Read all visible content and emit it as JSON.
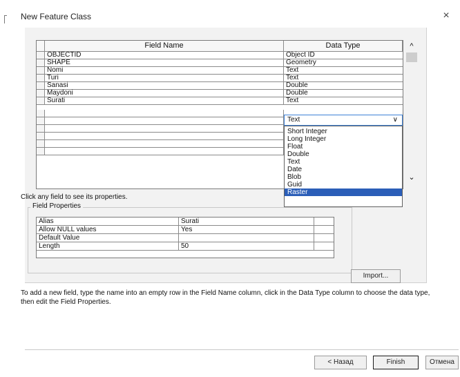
{
  "window": {
    "title": "New Feature Class",
    "close_symbol": "×"
  },
  "grid": {
    "headers": {
      "field_name": "Field Name",
      "data_type": "Data Type"
    },
    "rows": [
      {
        "name": "OBJECTID",
        "type": "Object ID"
      },
      {
        "name": "SHAPE",
        "type": "Geometry"
      },
      {
        "name": "Nomi",
        "type": "Text"
      },
      {
        "name": "Turi",
        "type": "Text"
      },
      {
        "name": "Sanasi",
        "type": "Double"
      },
      {
        "name": "Maydoni",
        "type": "Double"
      },
      {
        "name": "Surati",
        "type": "Text"
      },
      {
        "name": "",
        "type": ""
      },
      {
        "name": "",
        "type": ""
      },
      {
        "name": "",
        "type": ""
      },
      {
        "name": "",
        "type": ""
      },
      {
        "name": "",
        "type": ""
      },
      {
        "name": "",
        "type": ""
      }
    ]
  },
  "type_dropdown": {
    "selected": "Text",
    "chevron": "∨",
    "options": [
      "Short Integer",
      "Long Integer",
      "Float",
      "Double",
      "Text",
      "Date",
      "Blob",
      "Guid",
      "Raster"
    ],
    "highlighted": "Raster"
  },
  "scrollbar": {
    "up_arrow": "^",
    "down_arrow": "⌄"
  },
  "hint_text": "Click any field to see its properties.",
  "field_properties": {
    "legend": "Field Properties",
    "rows": [
      {
        "key": "Alias",
        "value": "Surati"
      },
      {
        "key": "Allow NULL values",
        "value": "Yes"
      },
      {
        "key": "Default Value",
        "value": ""
      },
      {
        "key": "Length",
        "value": "50"
      }
    ]
  },
  "buttons": {
    "import": "Import...",
    "back": "< Назад",
    "finish": "Finish",
    "cancel": "Отмена"
  },
  "instructions": "To add a new field, type the name into an empty row in the Field Name column, click in the Data Type column to choose the data type, then edit the Field Properties."
}
